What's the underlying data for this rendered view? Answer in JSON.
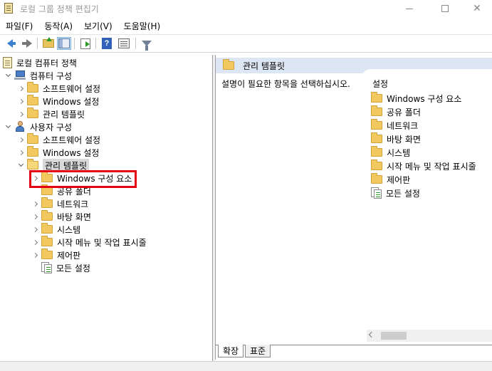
{
  "window": {
    "title": "로컬 그룹 정책 편집기"
  },
  "menu": {
    "items": [
      "파일(F)",
      "동작(A)",
      "보기(V)",
      "도움말(H)"
    ]
  },
  "toolbar": {
    "buttons": [
      "back-icon",
      "forward-icon",
      "up-folder-icon",
      "show-hide-tree-icon",
      "export-list-icon",
      "help-icon",
      "properties-icon",
      "filter-icon"
    ]
  },
  "tree": {
    "root": "로컬 컴퓨터 정책",
    "computer_config": "컴퓨터 구성",
    "cc_software": "소프트웨어 설정",
    "cc_windows": "Windows 설정",
    "cc_admin": "관리 템플릿",
    "user_config": "사용자 구성",
    "uc_software": "소프트웨어 설정",
    "uc_windows": "Windows 설정",
    "uc_admin": "관리 템플릿",
    "uc_admin_children": [
      "Windows 구성 요소",
      "공유 폴더",
      "네트워크",
      "바탕 화면",
      "시스템",
      "시작 메뉴 및 작업 표시줄",
      "제어판",
      "모든 설정"
    ]
  },
  "right": {
    "header_title": "관리 템플릿",
    "description": "설명이 필요한 항목을 선택하십시오.",
    "column_header": "설정",
    "items": [
      "Windows 구성 요소",
      "공유 폴더",
      "네트워크",
      "바탕 화면",
      "시스템",
      "시작 메뉴 및 작업 표시줄",
      "제어판",
      "모든 설정"
    ]
  },
  "tabs": [
    "확장",
    "표준"
  ],
  "colors": {
    "header_bg": "#dde7f3",
    "highlight": "#e60012",
    "selection": "#d9d9d9"
  }
}
